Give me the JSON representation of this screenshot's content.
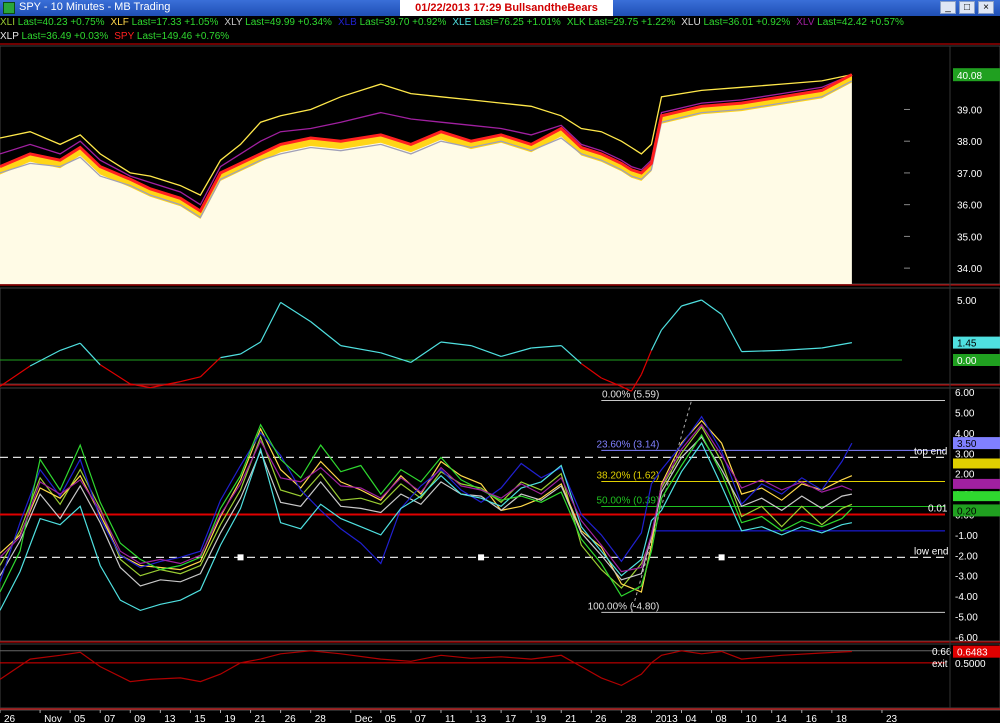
{
  "window": {
    "title": "SPY - 10 Minutes - MB Trading",
    "banner": "01/22/2013  17:29  BullsandtheBears",
    "buttons": [
      "_",
      "□",
      "×"
    ]
  },
  "legend_rows": [
    [
      {
        "name": "XLI",
        "text": "Last=40.23 +0.75%",
        "color": "#9acd32"
      },
      {
        "name": "XLF",
        "text": "Last=17.33 +1.05%",
        "color": "#ffd84a"
      },
      {
        "name": "XLY",
        "text": "Last=49.99 +0.34%",
        "color": "#c8c8c8"
      },
      {
        "name": "XLB",
        "text": "Last=39.70 +0.92%",
        "color": "#2020d0"
      },
      {
        "name": "XLE",
        "text": "Last=76.25 +1.01%",
        "color": "#4fe0e0"
      },
      {
        "name": "XLK",
        "text": "Last=29.75 +1.22%",
        "color": "#2fd82f"
      },
      {
        "name": "XLU",
        "text": "Last=36.01 +0.92%",
        "color": "#dddddd"
      },
      {
        "name": "XLV",
        "text": "Last=42.42 +0.57%",
        "color": "#a020a0"
      }
    ],
    [
      {
        "name": "XLP",
        "text": "Last=36.49 +0.03%",
        "color": "#e8e8e8"
      },
      {
        "name": "SPY",
        "text": "Last=149.46 +0.76%",
        "color": "#ff2020"
      }
    ]
  ],
  "colors": {
    "accent_red": "#e00000",
    "sky": "#4fe0e0",
    "dark_red": "#b00000",
    "gold": "#ffd000",
    "cream": "#fffbe6",
    "grid": "#ffffff"
  },
  "x_axis_ticks": [
    {
      "label": "26",
      "x": 0
    },
    {
      "label": "Nov",
      "x": 4
    },
    {
      "label": "05",
      "x": 7
    },
    {
      "label": "07",
      "x": 10
    },
    {
      "label": "09",
      "x": 13
    },
    {
      "label": "13",
      "x": 16
    },
    {
      "label": "15",
      "x": 19
    },
    {
      "label": "19",
      "x": 22
    },
    {
      "label": "21",
      "x": 25
    },
    {
      "label": "26",
      "x": 28
    },
    {
      "label": "28",
      "x": 31
    },
    {
      "label": "Dec",
      "x": 35
    },
    {
      "label": "05",
      "x": 38
    },
    {
      "label": "07",
      "x": 41
    },
    {
      "label": "11",
      "x": 44
    },
    {
      "label": "13",
      "x": 47
    },
    {
      "label": "17",
      "x": 50
    },
    {
      "label": "19",
      "x": 53
    },
    {
      "label": "21",
      "x": 56
    },
    {
      "label": "26",
      "x": 59
    },
    {
      "label": "28",
      "x": 62
    },
    {
      "label": "2013",
      "x": 65
    },
    {
      "label": "04",
      "x": 68
    },
    {
      "label": "08",
      "x": 71
    },
    {
      "label": "10",
      "x": 74
    },
    {
      "label": "14",
      "x": 77
    },
    {
      "label": "16",
      "x": 80
    },
    {
      "label": "18",
      "x": 83
    },
    {
      "label": "23",
      "x": 88
    }
  ],
  "chart_data": [
    {
      "type": "line",
      "title": "",
      "ylim": [
        33.5,
        41
      ],
      "y_ticks": [
        "39.00",
        "38.00",
        "37.00",
        "36.00",
        "35.00",
        "34.00"
      ],
      "last_value_label": "40.08",
      "x": [
        0,
        3,
        6,
        8,
        10,
        13,
        15,
        18,
        20,
        22,
        24,
        26,
        28,
        31,
        34,
        38,
        41,
        44,
        47,
        50,
        53,
        56,
        58,
        60,
        62,
        63,
        64,
        65,
        66,
        70,
        74,
        78,
        82,
        85
      ],
      "series": [
        {
          "name": "SPY",
          "color": "#ff2020",
          "values": [
            37.2,
            37.6,
            37.4,
            37.8,
            37.2,
            36.8,
            36.5,
            36.2,
            35.8,
            37.0,
            37.3,
            37.6,
            37.9,
            38.1,
            38.0,
            38.2,
            37.9,
            38.3,
            38.0,
            38.2,
            37.9,
            38.4,
            37.8,
            37.6,
            37.3,
            37.1,
            37.0,
            37.3,
            38.8,
            39.1,
            39.2,
            39.4,
            39.6,
            40.1
          ]
        },
        {
          "name": "XLF",
          "color": "#ffe84a",
          "values": [
            38.1,
            38.3,
            37.9,
            38.2,
            37.6,
            37.0,
            36.9,
            36.6,
            36.3,
            37.4,
            37.9,
            38.6,
            38.8,
            39.0,
            39.4,
            39.8,
            39.5,
            39.4,
            39.3,
            39.2,
            39.1,
            38.8,
            38.4,
            38.3,
            38.0,
            37.8,
            37.6,
            37.9,
            39.4,
            39.6,
            39.7,
            39.8,
            39.9,
            40.1
          ]
        },
        {
          "name": "XLV",
          "color": "#a020a0",
          "values": [
            37.6,
            37.9,
            37.6,
            38.0,
            37.4,
            36.9,
            36.7,
            36.4,
            36.0,
            37.2,
            37.6,
            38.0,
            38.3,
            38.4,
            38.6,
            38.9,
            38.7,
            38.6,
            38.5,
            38.4,
            38.2,
            38.5,
            37.9,
            37.7,
            37.4,
            37.2,
            37.1,
            37.4,
            38.9,
            39.2,
            39.3,
            39.5,
            39.7,
            40.1
          ]
        },
        {
          "name": "XLY",
          "color": "#a0a0b8",
          "values": [
            37.0,
            37.3,
            37.2,
            37.5,
            36.9,
            36.6,
            36.3,
            36.0,
            35.6,
            36.8,
            37.1,
            37.4,
            37.6,
            37.8,
            37.7,
            37.9,
            37.6,
            38.0,
            37.8,
            38.0,
            37.7,
            38.1,
            37.6,
            37.4,
            37.1,
            36.9,
            36.8,
            37.1,
            38.6,
            38.9,
            39.0,
            39.2,
            39.4,
            39.9
          ]
        }
      ]
    },
    {
      "type": "line",
      "title": "",
      "ylim": [
        -2,
        6
      ],
      "y_ticks": [
        "5.00"
      ],
      "last_value_labels": [
        "1.45",
        "0.00"
      ],
      "x": [
        0,
        3,
        6,
        8,
        10,
        13,
        15,
        18,
        20,
        22,
        24,
        26,
        28,
        31,
        34,
        38,
        41,
        44,
        47,
        50,
        53,
        56,
        58,
        60,
        62,
        63,
        64,
        65,
        66,
        68,
        70,
        72,
        74,
        78,
        82,
        85
      ],
      "series": [
        {
          "name": "diff",
          "values": [
            -2.2,
            -0.5,
            0.8,
            1.4,
            -0.4,
            -2.0,
            -2.3,
            -1.8,
            -1.4,
            0.2,
            0.5,
            1.5,
            4.8,
            3.2,
            1.2,
            0.6,
            -0.2,
            1.5,
            1.2,
            0.3,
            1.0,
            1.2,
            -0.3,
            -1.5,
            -2.2,
            -2.6,
            -1.2,
            0.8,
            2.5,
            4.5,
            5.0,
            3.8,
            0.7,
            0.8,
            1.0,
            1.45
          ]
        }
      ]
    },
    {
      "type": "line",
      "title": "",
      "ylim": [
        -6.2,
        6.2
      ],
      "y_ticks": [
        "6.00",
        "5.00",
        "4.00",
        "3.00",
        "2.00",
        "1.00",
        "0.00",
        "-1.00",
        "-2.00",
        "-3.00",
        "-4.00",
        "-5.00",
        "-6.00"
      ],
      "fib_levels": [
        {
          "label": "0.00% (5.59)",
          "value": 5.59,
          "color": "#c8c8c8"
        },
        {
          "label": "23.60% (3.14)",
          "value": 3.14,
          "color": "#8080ff"
        },
        {
          "label": "38.20% (1.62)",
          "value": 1.62,
          "color": "#e0d000"
        },
        {
          "label": "50.00% (0.39)",
          "value": 0.39,
          "color": "#20c020"
        },
        {
          "label": "100.00% (-4.80)",
          "value": -4.8,
          "color": "#c8c8c8"
        }
      ],
      "fib_span": [
        58,
        85
      ],
      "blue_level": -0.8,
      "top_end": {
        "label": "top end",
        "value": 2.8,
        "right_label": "3.00"
      },
      "low_end": {
        "label": "low end",
        "value": -2.1,
        "right_label": "2.00"
      },
      "zero_line_label": "0.01",
      "right_badges": [
        "3.50",
        "0.20"
      ],
      "x": [
        0,
        2,
        4,
        6,
        8,
        10,
        12,
        14,
        16,
        18,
        20,
        22,
        24,
        26,
        28,
        30,
        32,
        34,
        36,
        38,
        40,
        42,
        44,
        46,
        48,
        50,
        52,
        54,
        56,
        58,
        60,
        62,
        64,
        65,
        66,
        68,
        70,
        72,
        74,
        76,
        78,
        80,
        82,
        84,
        85
      ],
      "series": [
        {
          "name": "XLI",
          "color": "#9acd32",
          "values": [
            -2.5,
            -0.8,
            1.8,
            0.5,
            2.2,
            0.3,
            -2.2,
            -3.0,
            -2.7,
            -2.9,
            -2.5,
            -0.5,
            1.2,
            3.8,
            1.2,
            0.9,
            2.0,
            0.7,
            0.8,
            0.5,
            1.5,
            0.8,
            2.1,
            1.5,
            1.3,
            0.6,
            1.6,
            1.2,
            2.0,
            -1.5,
            -2.7,
            -3.6,
            -2.4,
            -1.2,
            1.3,
            3.0,
            4.3,
            2.6,
            -0.1,
            0.4,
            -0.6,
            0.4,
            -0.5,
            0.3,
            0.5
          ]
        },
        {
          "name": "XLF",
          "color": "#ffd84a",
          "values": [
            -1.9,
            -1.0,
            1.3,
            0.8,
            1.9,
            0.0,
            -2.0,
            -2.5,
            -2.6,
            -2.7,
            -2.3,
            -0.1,
            1.7,
            4.2,
            2.2,
            1.3,
            2.6,
            1.6,
            1.2,
            0.7,
            1.9,
            1.0,
            2.6,
            1.9,
            1.5,
            0.2,
            0.4,
            0.8,
            1.5,
            -0.8,
            -1.6,
            -3.4,
            -3.8,
            -1.5,
            1.5,
            3.5,
            4.6,
            3.5,
            1.0,
            1.3,
            0.7,
            1.5,
            1.2,
            1.7,
            1.9
          ]
        },
        {
          "name": "XLY",
          "color": "#c8c8c8",
          "values": [
            -3.0,
            -1.3,
            1.0,
            -0.2,
            1.4,
            -0.4,
            -2.6,
            -3.5,
            -3.2,
            -3.3,
            -2.9,
            -0.9,
            0.8,
            3.1,
            0.6,
            0.4,
            1.6,
            0.4,
            0.3,
            0.1,
            1.0,
            0.5,
            1.6,
            1.0,
            0.9,
            0.2,
            1.0,
            0.7,
            1.4,
            -0.9,
            -2.0,
            -3.2,
            -2.9,
            -1.1,
            1.1,
            2.8,
            3.8,
            2.2,
            0.4,
            0.8,
            0.2,
            0.9,
            0.3,
            0.9,
            1.0
          ]
        },
        {
          "name": "XLB",
          "color": "#2020d0",
          "values": [
            -3.3,
            -0.4,
            2.2,
            0.9,
            2.7,
            -0.2,
            -2.0,
            -2.6,
            -2.3,
            -2.1,
            -1.8,
            0.7,
            2.4,
            4.0,
            2.9,
            1.2,
            0.2,
            -0.7,
            -1.4,
            -2.4,
            0.3,
            1.4,
            2.2,
            1.2,
            0.6,
            1.3,
            2.5,
            1.8,
            2.3,
            0.0,
            -1.0,
            -2.3,
            -0.9,
            1.5,
            2.2,
            3.4,
            4.8,
            3.1,
            0.5,
            1.5,
            1.0,
            1.8,
            1.2,
            2.6,
            3.5
          ]
        },
        {
          "name": "XLE",
          "color": "#4fe0e0",
          "values": [
            -4.7,
            -2.8,
            -0.2,
            -0.5,
            0.4,
            -2.5,
            -4.2,
            -4.7,
            -4.4,
            -4.2,
            -3.7,
            -1.5,
            0.3,
            3.2,
            -0.4,
            -0.7,
            0.5,
            -0.2,
            -0.6,
            -1.0,
            0.3,
            0.9,
            1.9,
            1.0,
            0.8,
            0.4,
            1.3,
            1.6,
            2.4,
            -0.6,
            -1.8,
            -3.0,
            -2.2,
            -0.3,
            0.2,
            2.1,
            3.5,
            1.4,
            -0.8,
            -0.6,
            -1.0,
            -0.6,
            -0.9,
            -0.5,
            -0.4
          ]
        },
        {
          "name": "XLK",
          "color": "#2fd82f",
          "values": [
            -3.8,
            -1.8,
            2.7,
            1.2,
            3.4,
            0.6,
            -1.4,
            -2.2,
            -2.7,
            -2.5,
            -2.1,
            0.3,
            1.9,
            4.4,
            2.7,
            1.8,
            3.4,
            2.1,
            2.4,
            1.0,
            2.2,
            1.6,
            2.8,
            1.7,
            1.2,
            0.7,
            0.9,
            0.6,
            1.1,
            -1.2,
            -2.4,
            -4.0,
            -3.5,
            -1.8,
            0.8,
            2.4,
            3.9,
            2.0,
            -0.4,
            -0.1,
            -0.8,
            -0.3,
            -0.6,
            -0.2,
            0.3
          ]
        },
        {
          "name": "XLV",
          "color": "#a020a0",
          "values": [
            -2.1,
            -1.1,
            1.6,
            1.0,
            1.7,
            0.2,
            -1.8,
            -2.4,
            -2.2,
            -2.4,
            -2.0,
            0.0,
            1.5,
            3.6,
            1.8,
            1.6,
            2.3,
            1.4,
            1.3,
            0.8,
            1.8,
            1.1,
            2.3,
            1.4,
            1.2,
            0.8,
            1.5,
            1.0,
            1.8,
            -0.3,
            -1.5,
            -2.8,
            -2.6,
            -1.0,
            1.4,
            3.2,
            4.4,
            2.9,
            1.3,
            1.7,
            1.2,
            1.6,
            1.1,
            1.4,
            1.2
          ]
        }
      ]
    },
    {
      "type": "line",
      "title": "",
      "ylim": [
        -0.1,
        0.75
      ],
      "reference_lines": [
        {
          "label": "0.66",
          "value": 0.66
        },
        {
          "label": "exit",
          "value": 0.5
        }
      ],
      "y_ticks": [
        "0.5000"
      ],
      "last_value_label": "0.6483",
      "x": [
        0,
        3,
        6,
        8,
        10,
        13,
        15,
        18,
        20,
        22,
        24,
        26,
        28,
        31,
        34,
        38,
        41,
        44,
        47,
        50,
        53,
        56,
        58,
        60,
        62,
        64,
        65,
        66,
        68,
        70,
        72,
        74,
        78,
        82,
        85
      ],
      "series": [
        {
          "name": "corr",
          "color": "#b00000",
          "values": [
            0.28,
            0.55,
            0.6,
            0.64,
            0.45,
            0.25,
            0.28,
            0.3,
            0.25,
            0.35,
            0.5,
            0.55,
            0.62,
            0.66,
            0.62,
            0.55,
            0.52,
            0.6,
            0.56,
            0.58,
            0.55,
            0.6,
            0.45,
            0.3,
            0.2,
            0.35,
            0.5,
            0.6,
            0.66,
            0.62,
            0.65,
            0.55,
            0.6,
            0.63,
            0.65
          ]
        }
      ]
    }
  ]
}
